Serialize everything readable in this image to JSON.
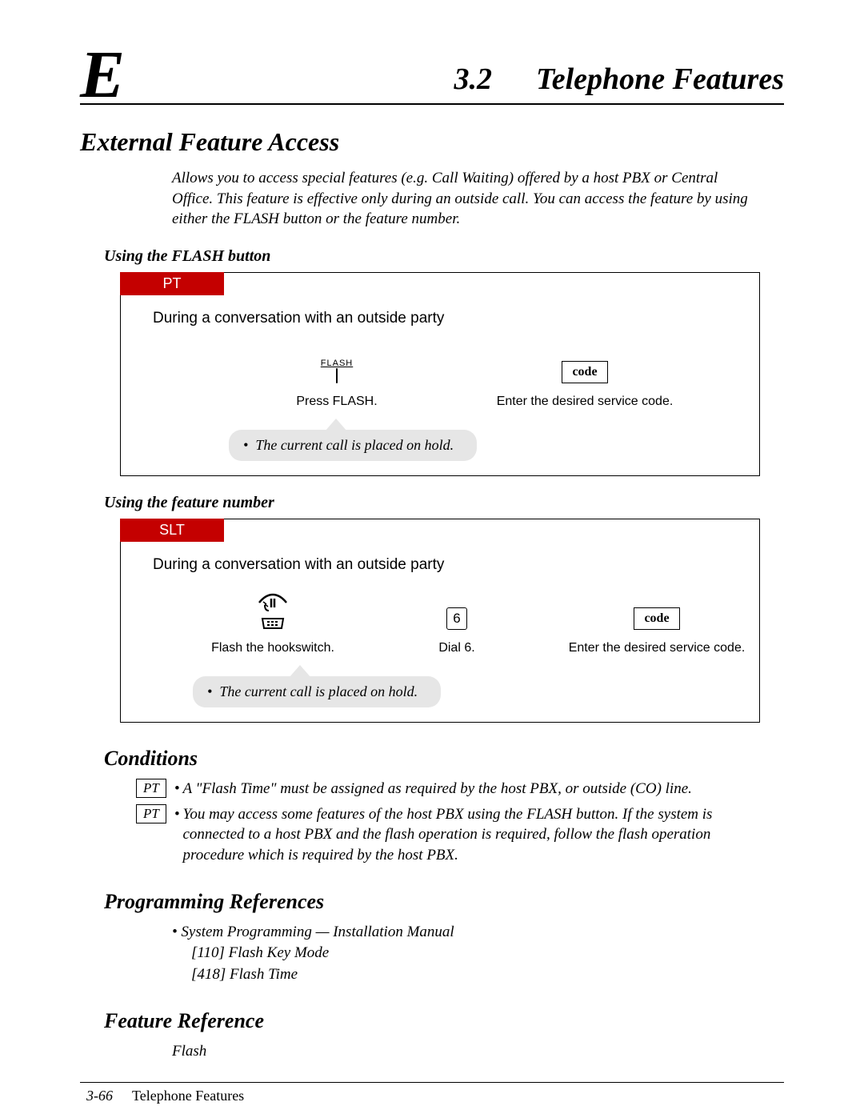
{
  "header": {
    "letter": "E",
    "number": "3.2",
    "title": "Telephone Features"
  },
  "section_title": "External Feature Access",
  "intro": "Allows you to access special features (e.g. Call Waiting) offered by a host PBX or Central Office. This feature is effective only during an outside call. You can access the feature by using either the FLASH button or the feature number.",
  "proc1": {
    "heading": "Using the FLASH button",
    "tab": "PT",
    "condition": "During a conversation with an outside party",
    "steps": {
      "flash_label": "FLASH",
      "flash_caption": "Press FLASH.",
      "code_label": "code",
      "code_caption": "Enter the desired service code."
    },
    "callout": "The current call is placed on hold."
  },
  "proc2": {
    "heading": "Using the feature number",
    "tab": "SLT",
    "condition": "During a conversation with an outside party",
    "steps": {
      "hookswitch_caption": "Flash the hookswitch.",
      "dial_digit": "6",
      "dial_caption": "Dial 6.",
      "code_label": "code",
      "code_caption": "Enter the desired service code."
    },
    "callout": "The current call is placed on hold."
  },
  "conditions": {
    "heading": "Conditions",
    "items": [
      {
        "badge": "PT",
        "text": "A \"Flash Time\" must be assigned as required by the host PBX, or outside (CO) line."
      },
      {
        "badge": "PT",
        "text": "You may access some features of the host PBX using the FLASH button. If the system is connected to a host PBX and the flash operation is required, follow the flash operation procedure which is required by the host PBX."
      }
    ]
  },
  "programming": {
    "heading": "Programming References",
    "line1": "System Programming — Installation Manual",
    "ref1": "[110]  Flash Key Mode",
    "ref2": "[418]  Flash Time"
  },
  "feature_ref": {
    "heading": "Feature Reference",
    "item": "Flash"
  },
  "footer": {
    "page": "3-66",
    "label": "Telephone Features"
  }
}
